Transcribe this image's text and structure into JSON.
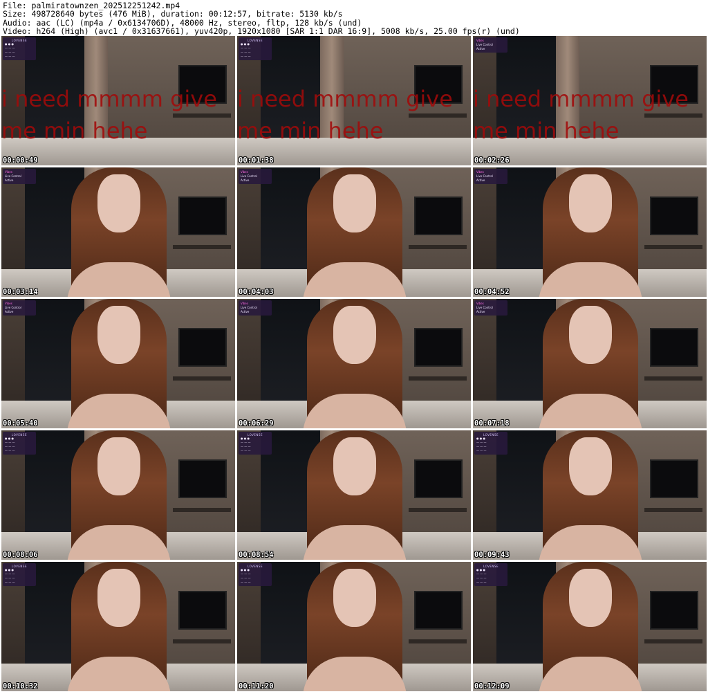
{
  "header": {
    "file": "File: palmiratownzen_202512251242.mp4",
    "size": "Size: 498728640 bytes (476 MiB), duration: 00:12:57, bitrate: 5130 kb/s",
    "audio": "Audio: aac (LC) (mp4a / 0x6134706D), 48000 Hz, stereo, fltp, 128 kb/s (und)",
    "video": "Video: h264 (High) (avc1 / 0x31637661), yuv420p, 1920x1080 [SAR 1:1 DAR 16:9], 5008 kb/s, 25.00 fps(r) (und)"
  },
  "thumbnails": [
    {
      "time": "00:00:49",
      "overlay_line1": "i need mmmm give",
      "overlay_line2": "me min hehe",
      "panel": "lovense"
    },
    {
      "time": "00:01:38",
      "overlay_line1": "i need mmmm give",
      "overlay_line2": "me min hehe",
      "panel": "lovense"
    },
    {
      "time": "00:02:26",
      "overlay_line1": "i need mmmm give",
      "overlay_line2": "me min hehe",
      "panel": "control"
    },
    {
      "time": "00:03:14",
      "overlay_line1": "",
      "overlay_line2": "",
      "panel": "control"
    },
    {
      "time": "00:04:03",
      "overlay_line1": "",
      "overlay_line2": "",
      "panel": "control"
    },
    {
      "time": "00:04:52",
      "overlay_line1": "",
      "overlay_line2": "",
      "panel": "control"
    },
    {
      "time": "00:05:40",
      "overlay_line1": "",
      "overlay_line2": "",
      "panel": "control"
    },
    {
      "time": "00:06:29",
      "overlay_line1": "",
      "overlay_line2": "",
      "panel": "control"
    },
    {
      "time": "00:07:18",
      "overlay_line1": "",
      "overlay_line2": "",
      "panel": "control"
    },
    {
      "time": "00:08:06",
      "overlay_line1": "",
      "overlay_line2": "",
      "panel": "lovense"
    },
    {
      "time": "00:08:54",
      "overlay_line1": "",
      "overlay_line2": "",
      "panel": "lovense"
    },
    {
      "time": "00:09:43",
      "overlay_line1": "",
      "overlay_line2": "",
      "panel": "lovense"
    },
    {
      "time": "00:10:32",
      "overlay_line1": "",
      "overlay_line2": "",
      "panel": "lovense"
    },
    {
      "time": "00:11:20",
      "overlay_line1": "",
      "overlay_line2": "",
      "panel": "lovense"
    },
    {
      "time": "00:12:09",
      "overlay_line1": "",
      "overlay_line2": "",
      "panel": "lovense"
    }
  ],
  "panel_labels": {
    "brand": "LOVENSE",
    "live_control": "Live Control",
    "tag": "Vibes",
    "active": "Active"
  }
}
